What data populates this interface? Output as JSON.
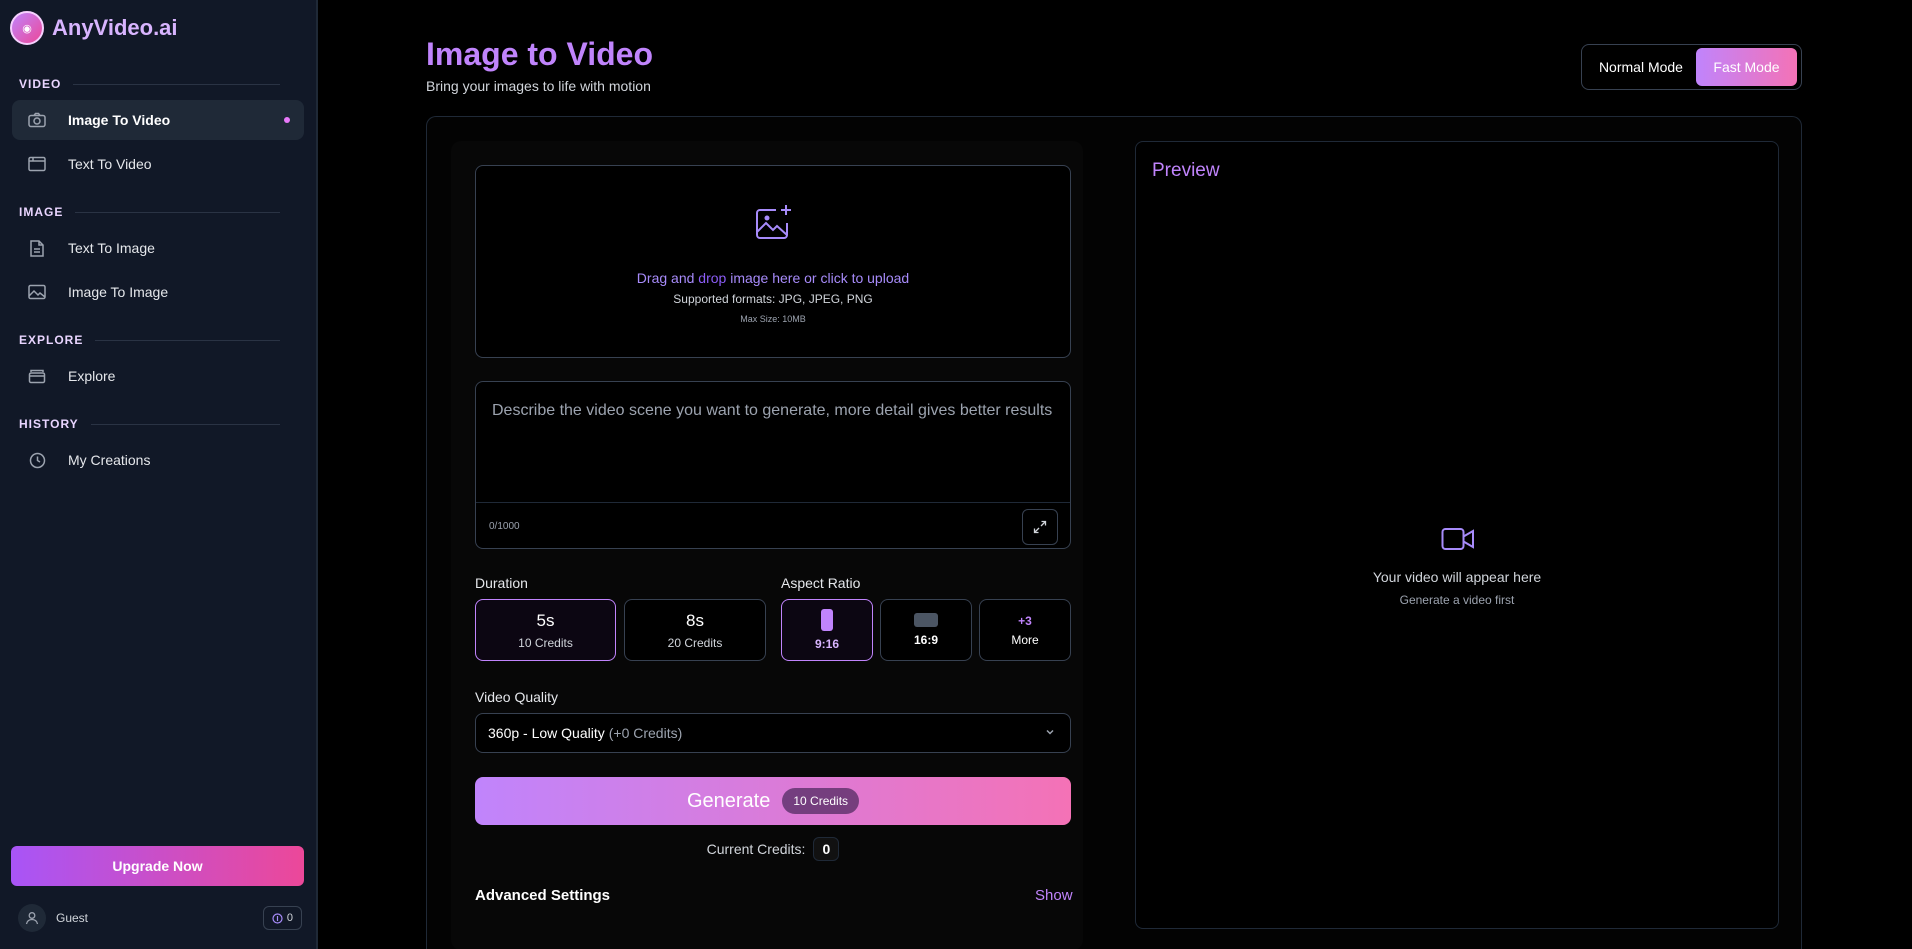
{
  "brand": {
    "name": "AnyVideo.ai",
    "logo_glyph": "◉"
  },
  "sidebar": {
    "sections": [
      {
        "title": "VIDEO",
        "items": [
          {
            "label": "Image To Video",
            "icon": "camera-icon",
            "active": true
          },
          {
            "label": "Text To Video",
            "icon": "film-icon",
            "active": false
          }
        ]
      },
      {
        "title": "IMAGE",
        "items": [
          {
            "label": "Text To Image",
            "icon": "document-icon",
            "active": false
          },
          {
            "label": "Image To Image",
            "icon": "image-icon",
            "active": false
          }
        ]
      },
      {
        "title": "EXPLORE",
        "items": [
          {
            "label": "Explore",
            "icon": "folder-icon",
            "active": false
          }
        ]
      },
      {
        "title": "HISTORY",
        "items": [
          {
            "label": "My Creations",
            "icon": "clock-icon",
            "active": false
          }
        ]
      }
    ],
    "upgrade_label": "Upgrade Now",
    "user_name": "Guest",
    "user_credits": "0"
  },
  "header": {
    "title": "Image to Video",
    "subtitle": "Bring your images to life with motion",
    "modes": {
      "normal": "Normal Mode",
      "fast": "Fast Mode",
      "selected": "fast"
    }
  },
  "upload": {
    "text_pre": "Drag and ",
    "text_highlight": "drop",
    "text_post": " image here or click to upload",
    "formats": "Supported formats: JPG, JPEG, PNG",
    "max_size": "Max Size: 10MB"
  },
  "prompt": {
    "placeholder": "Describe the video scene you want to generate, more detail gives better results",
    "value": "",
    "char_count": "0/1000"
  },
  "duration": {
    "label": "Duration",
    "options": [
      {
        "value": "5s",
        "credits": "10 Credits",
        "selected": true
      },
      {
        "value": "8s",
        "credits": "20 Credits",
        "selected": false
      }
    ]
  },
  "aspect_ratio": {
    "label": "Aspect Ratio",
    "options": [
      {
        "value": "9:16",
        "selected": true
      },
      {
        "value": "16:9",
        "selected": false
      }
    ],
    "more_count": "+3",
    "more_label": "More"
  },
  "quality": {
    "label": "Video Quality",
    "selected": "360p - Low Quality",
    "extra": "(+0 Credits)"
  },
  "generate": {
    "label": "Generate",
    "badge": "10 Credits",
    "current_credits_label": "Current Credits:",
    "current_credits": "0"
  },
  "advanced": {
    "title": "Advanced Settings",
    "toggle": "Show"
  },
  "preview": {
    "title": "Preview",
    "empty_main": "Your video will appear here",
    "empty_sub": "Generate a video first"
  },
  "colors": {
    "accent": "#c084fc",
    "pink": "#f472b6",
    "sidebar_bg": "#111827"
  }
}
